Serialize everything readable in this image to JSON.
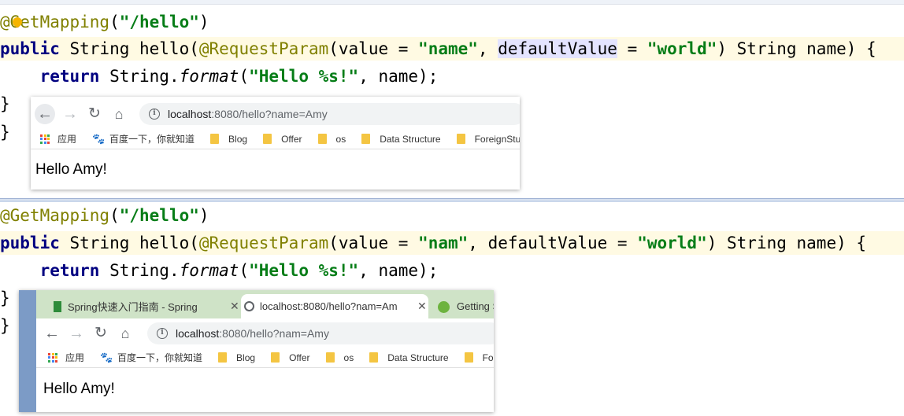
{
  "editor": {
    "block1": {
      "annotation": "@GetMapping",
      "path": "\"/hello\"",
      "sig_public": "public",
      "sig_type": " String hello(",
      "sig_param_ann": "@RequestParam",
      "sig_value_kw": "(value = ",
      "sig_value": "\"name\"",
      "sig_comma": ", ",
      "sig_default_kw": "defaultValue",
      "sig_eq": " = ",
      "sig_default": "\"world\"",
      "sig_tail": ") String name) {",
      "ret_kw": "return",
      "ret_type": " String.",
      "ret_method": "format",
      "ret_open": "(",
      "ret_fmt": "\"Hello %s!\"",
      "ret_tail": ", name);",
      "close1": "}",
      "close2": "}"
    },
    "block2": {
      "annotation": "@GetMapping",
      "path": "\"/hello\"",
      "sig_public": "public",
      "sig_type": " String hello(",
      "sig_param_ann": "@RequestParam",
      "sig_value_kw": "(value = ",
      "sig_value": "\"nam\"",
      "sig_comma": ", ",
      "sig_default_kw": "defaultValue",
      "sig_eq": " = ",
      "sig_default": "\"world\"",
      "sig_tail": ") String name) {",
      "ret_kw": "return",
      "ret_type": " String.",
      "ret_method": "format",
      "ret_open": "(",
      "ret_fmt": "\"Hello %s!\"",
      "ret_tail": ", name);",
      "close1": "}",
      "close2": "}"
    }
  },
  "browser1": {
    "url_host": "localhost",
    "url_path": ":8080/hello?name=Amy",
    "bookmarks": [
      "应用",
      "百度一下，你就知道",
      "Blog",
      "Offer",
      "os",
      "Data Structure",
      "ForeignStu"
    ],
    "page_text": "Hello Amy!"
  },
  "browser2": {
    "tabs": [
      {
        "label": "Spring快速入门指南 - Spring"
      },
      {
        "label": "localhost:8080/hello?nam=Am"
      },
      {
        "label": "Getting St"
      }
    ],
    "url_host": "localhost",
    "url_path": ":8080/hello?nam=Amy",
    "bookmarks": [
      "应用",
      "百度一下，你就知道",
      "Blog",
      "Offer",
      "os",
      "Data Structure",
      "Fo"
    ],
    "page_text": "Hello Amy!"
  },
  "colors": {
    "annotation": "#808000",
    "string": "#067d17",
    "keyword": "#000080",
    "highlight": "#e4e4ff",
    "tabbar": "#cfe3c7"
  }
}
